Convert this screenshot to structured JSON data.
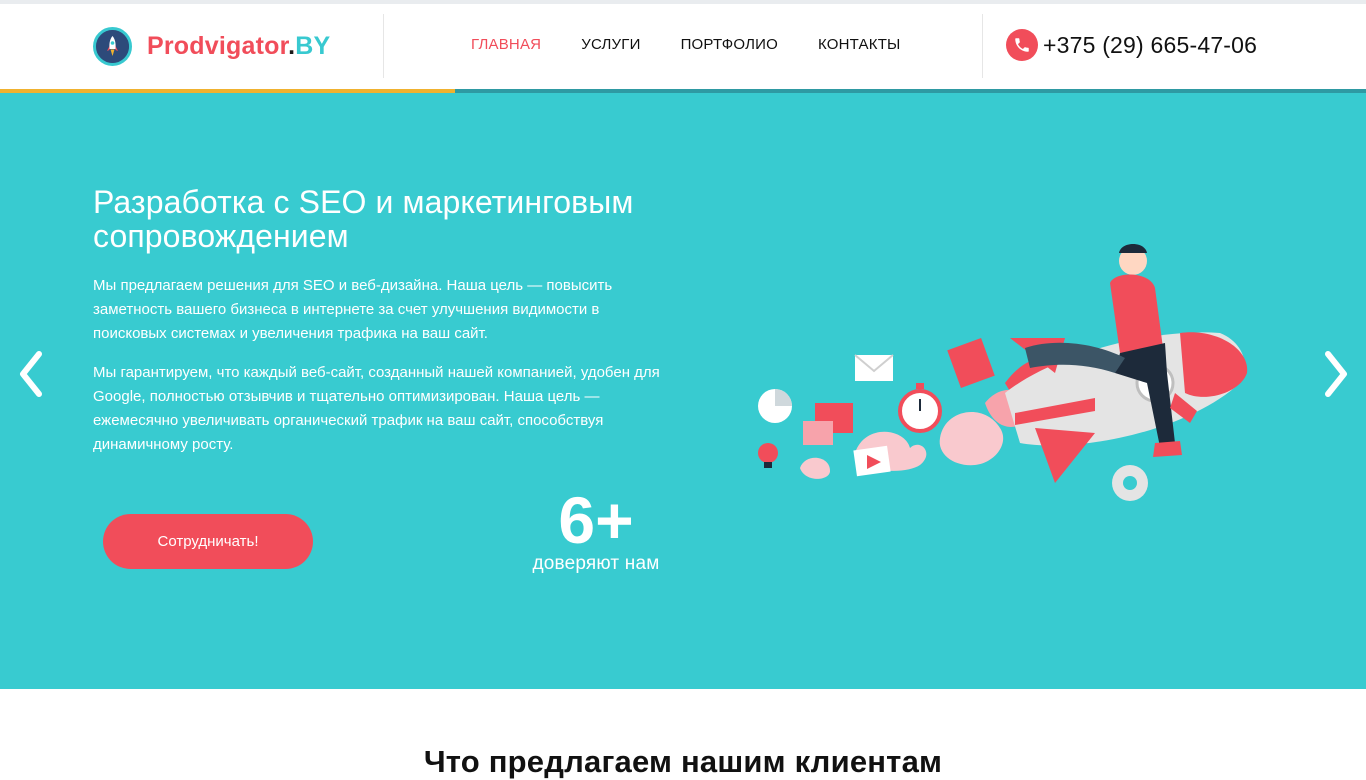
{
  "header": {
    "logo": {
      "part1": "Prodvigator",
      "part2": ".",
      "part3": "BY"
    },
    "nav": [
      {
        "label": "ГЛАВНАЯ",
        "active": true
      },
      {
        "label": "УСЛУГИ",
        "active": false
      },
      {
        "label": "ПОРТФОЛИО",
        "active": false
      },
      {
        "label": "КОНТАКТЫ",
        "active": false
      }
    ],
    "phone": "+375 (29) 665-47-06"
  },
  "hero": {
    "title": "Разработка с SEO и маркетинговым сопровождением",
    "paragraph1": "Мы предлагаем решения для SEO и веб-дизайна. Наша цель — повысить заметность вашего бизнеса в интернете за счет улучшения видимости в поисковых системах и увеличения трафика на ваш сайт.",
    "paragraph2": "Мы гарантируем, что каждый веб-сайт, созданный нашей компанией, удобен для Google, полностью отзывчив и тщательно оптимизирован. Наша цель — ежемесячно увеличивать органический трафик на ваш сайт, способствуя динамичному росту.",
    "cta_label": "Сотрудничать!",
    "stat_number": "6+",
    "stat_label": "доверяют нам"
  },
  "next_section": {
    "title": "Что предлагаем нашим клиентам"
  },
  "colors": {
    "brand_red": "#f14d5a",
    "brand_teal": "#38cbd0",
    "accent_gold": "#f0b22f",
    "accent_dark_teal": "#2e9aa3"
  },
  "icons": [
    "rocket-logo-icon",
    "phone-icon",
    "chevron-left-icon",
    "chevron-right-icon",
    "rocket-illustration"
  ]
}
